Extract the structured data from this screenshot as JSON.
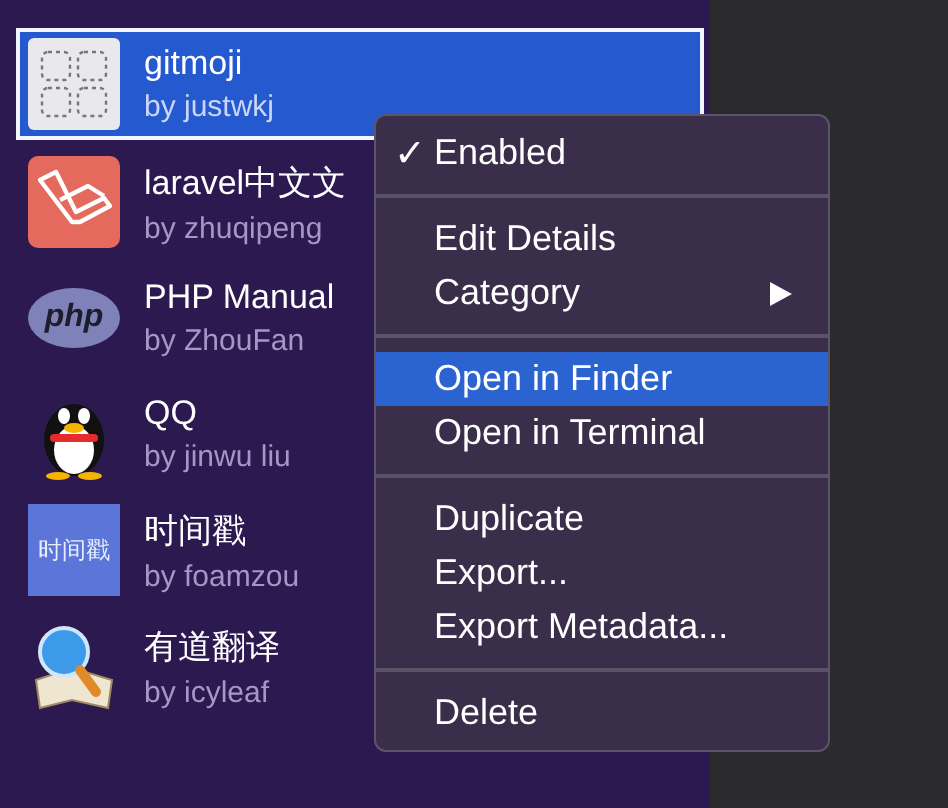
{
  "extensions": [
    {
      "title": "gitmoji",
      "author": "by justwkj",
      "selected": true,
      "icon": {
        "kind": "grid"
      }
    },
    {
      "title": "laravel中文文",
      "author": "by zhuqipeng",
      "selected": false,
      "icon": {
        "kind": "laravel"
      }
    },
    {
      "title": "PHP Manual",
      "author": "by ZhouFan",
      "selected": false,
      "icon": {
        "kind": "php",
        "text": "php"
      }
    },
    {
      "title": "QQ",
      "author": "by jinwu liu",
      "selected": false,
      "icon": {
        "kind": "penguin"
      }
    },
    {
      "title": "时间戳",
      "author": "by foamzou",
      "selected": false,
      "icon": {
        "kind": "text-tile",
        "text": "时间戳"
      }
    },
    {
      "title": "有道翻译",
      "author": "by icyleaf",
      "selected": false,
      "icon": {
        "kind": "magnifier-book"
      }
    }
  ],
  "context_menu": {
    "groups": [
      [
        {
          "label": "Enabled",
          "checked": true,
          "selected": false,
          "submenu": false
        }
      ],
      [
        {
          "label": "Edit Details",
          "checked": false,
          "selected": false,
          "submenu": false
        },
        {
          "label": "Category",
          "checked": false,
          "selected": false,
          "submenu": true
        }
      ],
      [
        {
          "label": "Open in Finder",
          "checked": false,
          "selected": true,
          "submenu": false
        },
        {
          "label": "Open in Terminal",
          "checked": false,
          "selected": false,
          "submenu": false
        }
      ],
      [
        {
          "label": "Duplicate",
          "checked": false,
          "selected": false,
          "submenu": false
        },
        {
          "label": "Export...",
          "checked": false,
          "selected": false,
          "submenu": false
        },
        {
          "label": "Export Metadata...",
          "checked": false,
          "selected": false,
          "submenu": false
        }
      ],
      [
        {
          "label": "Delete",
          "checked": false,
          "selected": false,
          "submenu": false
        }
      ]
    ],
    "check_mark": "✓"
  }
}
